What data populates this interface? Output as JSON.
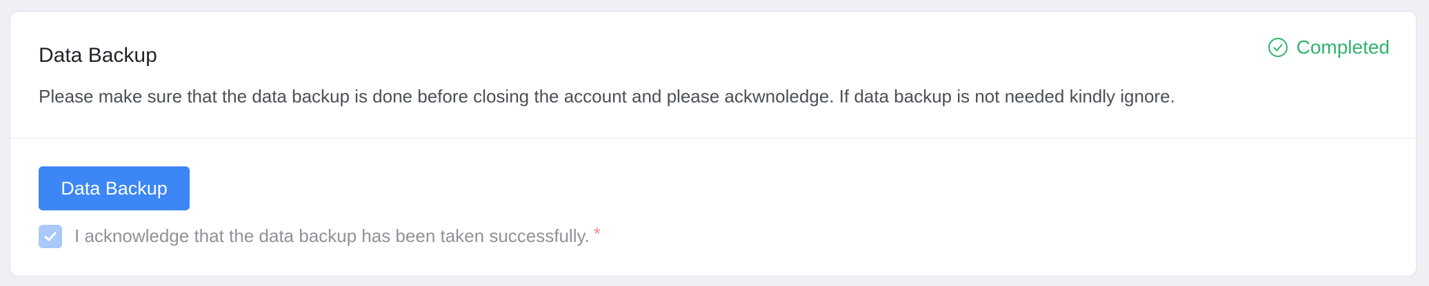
{
  "section": {
    "title": "Data Backup",
    "status_label": "Completed",
    "description": "Please make sure that the data backup is done before closing the account and please ackwnoledge. If data backup is not needed kindly ignore."
  },
  "actions": {
    "backup_button_label": "Data Backup"
  },
  "acknowledgement": {
    "label": "I acknowledge that the data backup has been taken successfully.",
    "required_marker": "*",
    "checked": true
  },
  "icons": {
    "status": "check-circle-icon",
    "checkbox": "check-icon"
  },
  "colors": {
    "status": "#2fb36b",
    "primary": "#3c86f5",
    "checkbox_disabled": "#a9c9fb",
    "required": "#f08a8a"
  }
}
